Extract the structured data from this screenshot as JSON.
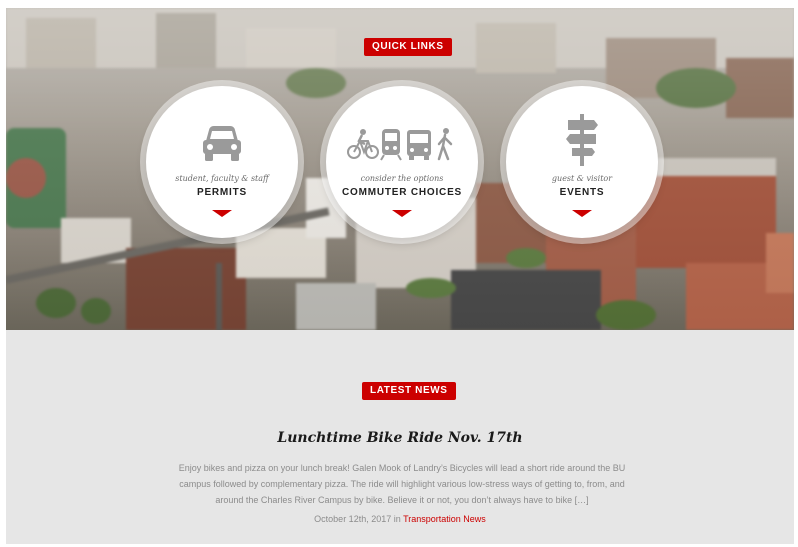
{
  "quick_links": {
    "label": "QUICK LINKS",
    "items": [
      {
        "subtitle": "student, faculty & staff",
        "title": "PERMITS",
        "icon": "car-icon"
      },
      {
        "subtitle": "consider the options",
        "title": "COMMUTER CHOICES",
        "icon": "commuter-modes-icon"
      },
      {
        "subtitle": "guest & visitor",
        "title": "EVENTS",
        "icon": "signpost-icon"
      }
    ]
  },
  "latest_news": {
    "label": "LATEST NEWS",
    "headline": "Lunchtime Bike Ride Nov. 17th",
    "excerpt": "Enjoy bikes and pizza on your lunch break! Galen Mook of Landry’s Bicycles will lead a short ride around the BU campus followed by complementary pizza. The ride will highlight various low-stress ways of getting to, from, and around the Charles River Campus by bike. Believe it or not, you don’t always have to bike […]",
    "date": "October 12th, 2017",
    "in_word": "in",
    "category": "Transportation News"
  },
  "colors": {
    "accent": "#cc0000",
    "news_background": "#e6e6e6",
    "icon_gray": "#9a9a9a"
  }
}
